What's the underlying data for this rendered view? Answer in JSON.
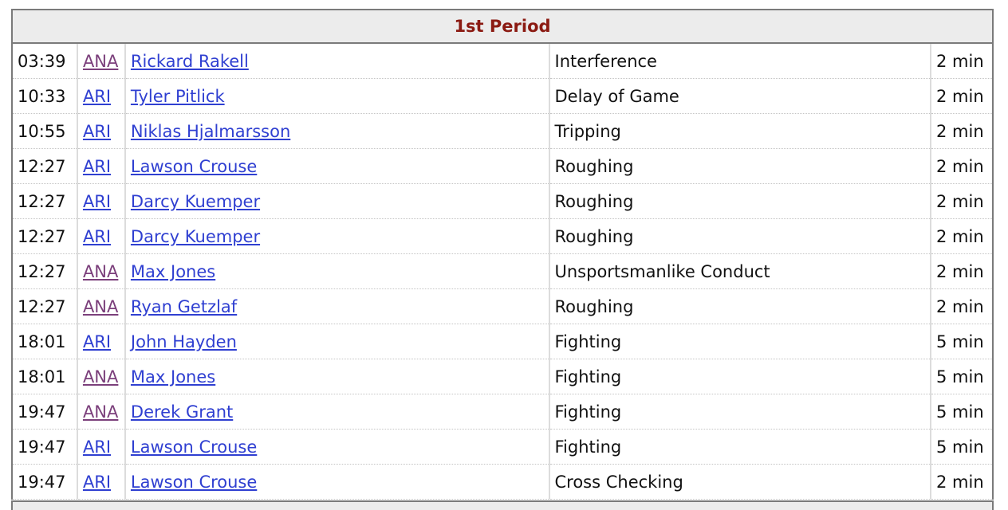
{
  "period_title": "1st Period",
  "penalties": [
    {
      "time": "03:39",
      "team": "ANA",
      "player": "Rickard Rakell",
      "penalty": "Interference",
      "duration": "2 min"
    },
    {
      "time": "10:33",
      "team": "ARI",
      "player": "Tyler Pitlick",
      "penalty": "Delay of Game",
      "duration": "2 min"
    },
    {
      "time": "10:55",
      "team": "ARI",
      "player": "Niklas Hjalmarsson",
      "penalty": "Tripping",
      "duration": "2 min"
    },
    {
      "time": "12:27",
      "team": "ARI",
      "player": "Lawson Crouse",
      "penalty": "Roughing",
      "duration": "2 min"
    },
    {
      "time": "12:27",
      "team": "ARI",
      "player": "Darcy Kuemper",
      "penalty": "Roughing",
      "duration": "2 min"
    },
    {
      "time": "12:27",
      "team": "ARI",
      "player": "Darcy Kuemper",
      "penalty": "Roughing",
      "duration": "2 min"
    },
    {
      "time": "12:27",
      "team": "ANA",
      "player": "Max Jones",
      "penalty": "Unsportsmanlike Conduct",
      "duration": "2 min"
    },
    {
      "time": "12:27",
      "team": "ANA",
      "player": "Ryan Getzlaf",
      "penalty": "Roughing",
      "duration": "2 min"
    },
    {
      "time": "18:01",
      "team": "ARI",
      "player": "John Hayden",
      "penalty": "Fighting",
      "duration": "5 min"
    },
    {
      "time": "18:01",
      "team": "ANA",
      "player": "Max Jones",
      "penalty": "Fighting",
      "duration": "5 min"
    },
    {
      "time": "19:47",
      "team": "ANA",
      "player": "Derek Grant",
      "penalty": "Fighting",
      "duration": "5 min"
    },
    {
      "time": "19:47",
      "team": "ARI",
      "player": "Lawson Crouse",
      "penalty": "Fighting",
      "duration": "5 min"
    },
    {
      "time": "19:47",
      "team": "ARI",
      "player": "Lawson Crouse",
      "penalty": "Cross Checking",
      "duration": "2 min"
    }
  ],
  "colors": {
    "period_title": "#8b1a12",
    "team_ana_link": "#7b3f7b",
    "team_ari_link": "#2f3fd1",
    "player_link": "#2f3fd1",
    "header_bg": "#ececec"
  }
}
